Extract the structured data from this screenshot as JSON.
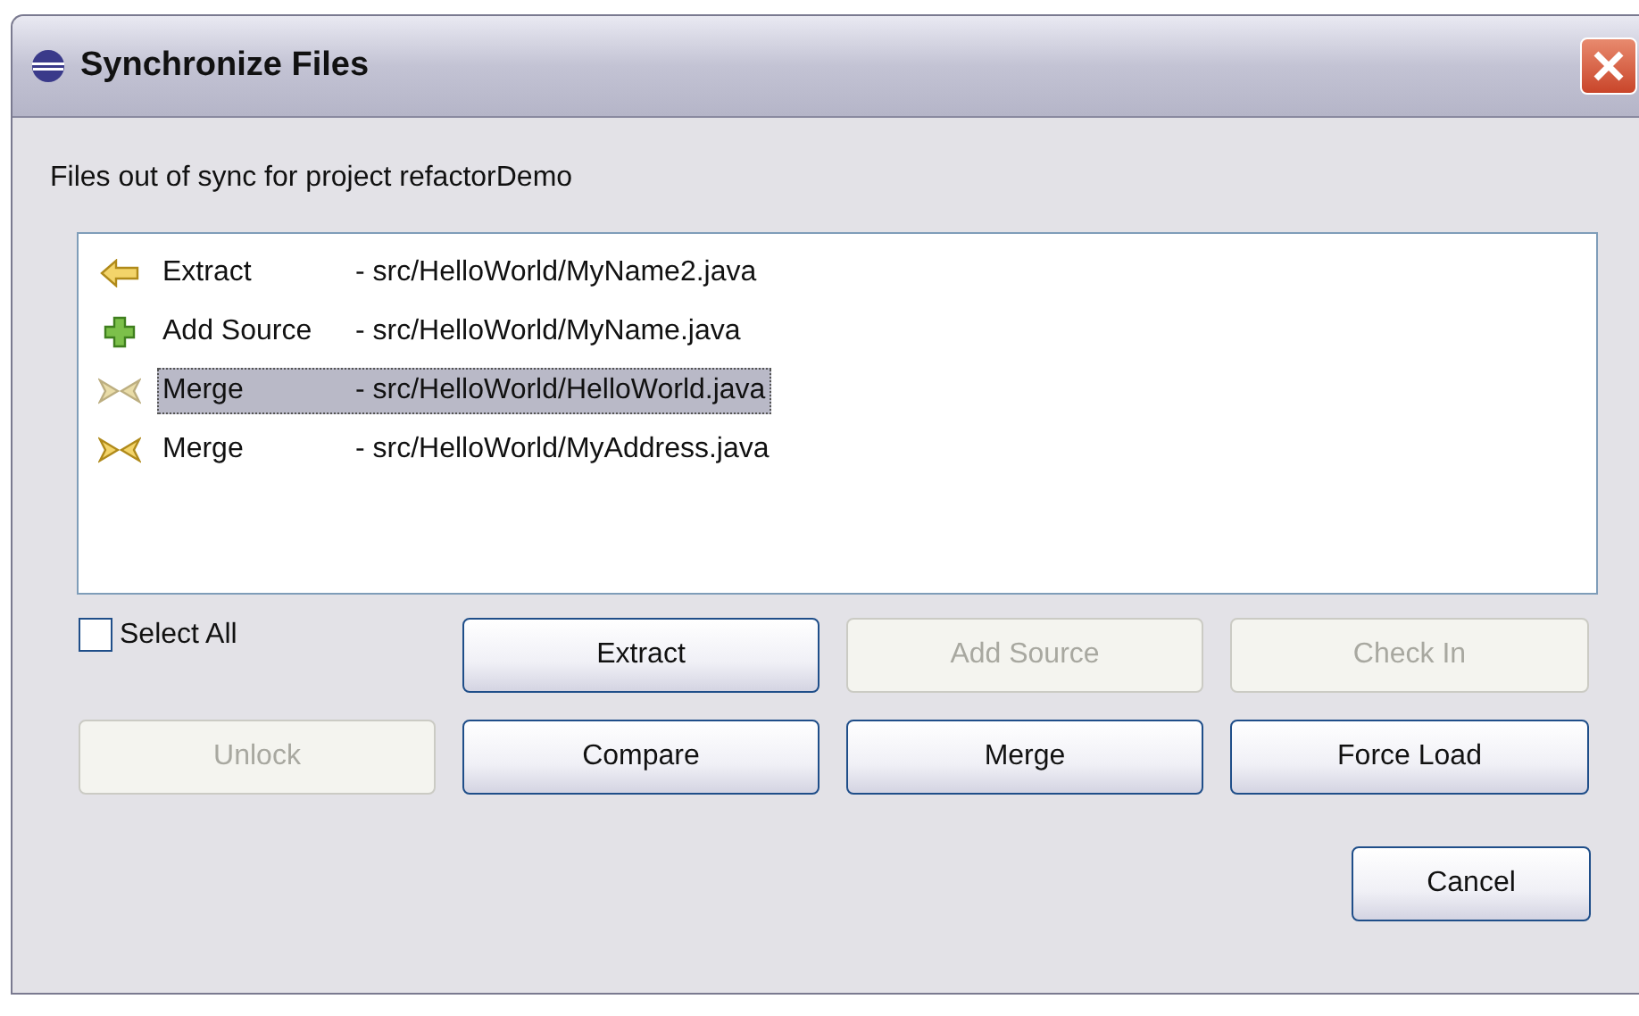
{
  "window": {
    "title": "Synchronize Files"
  },
  "message": "Files out of sync for project refactorDemo",
  "files": [
    {
      "kind": "extract",
      "action": "Extract",
      "path": "- src/HelloWorld/MyName2.java",
      "selected": false
    },
    {
      "kind": "add",
      "action": "Add Source",
      "path": "- src/HelloWorld/MyName.java",
      "selected": false
    },
    {
      "kind": "merge",
      "action": "Merge",
      "path": "- src/HelloWorld/HelloWorld.java",
      "selected": true
    },
    {
      "kind": "merge",
      "action": "Merge",
      "path": "- src/HelloWorld/MyAddress.java",
      "selected": false
    }
  ],
  "select_all": {
    "label": "Select All",
    "checked": false
  },
  "buttons": [
    {
      "label": "Extract",
      "disabled": false
    },
    {
      "label": "Add Source",
      "disabled": true
    },
    {
      "label": "Check In",
      "disabled": true
    },
    {
      "label": "Unlock",
      "disabled": true
    },
    {
      "label": "Compare",
      "disabled": false
    },
    {
      "label": "Merge",
      "disabled": false
    },
    {
      "label": "Force Load",
      "disabled": false
    }
  ],
  "cancel": {
    "label": "Cancel",
    "disabled": false
  }
}
